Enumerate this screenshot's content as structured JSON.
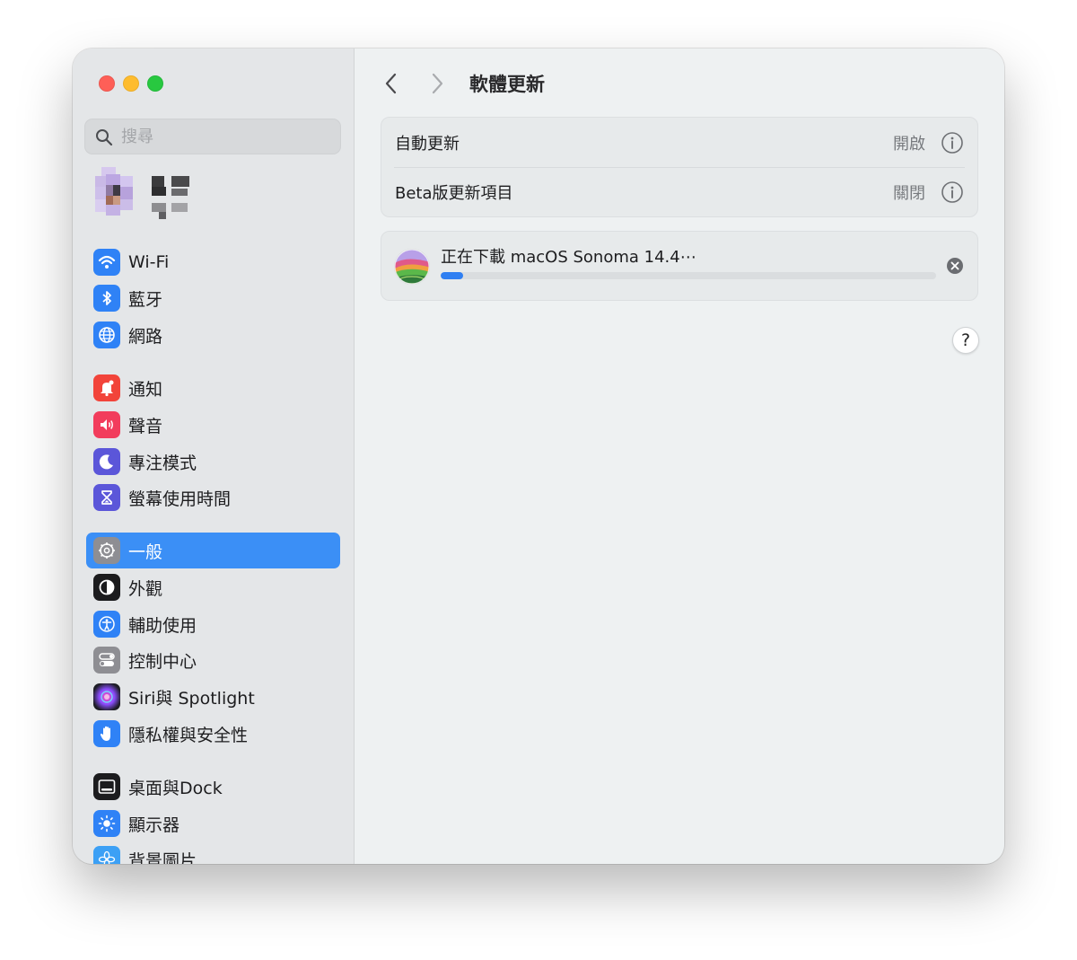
{
  "sidebar": {
    "search_placeholder": "搜尋",
    "items": [
      {
        "label": "Wi-Fi"
      },
      {
        "label": "藍牙"
      },
      {
        "label": "網路"
      },
      {
        "label": "通知"
      },
      {
        "label": "聲音"
      },
      {
        "label": "專注模式"
      },
      {
        "label": "螢幕使用時間"
      },
      {
        "label": "一般"
      },
      {
        "label": "外觀"
      },
      {
        "label": "輔助使用"
      },
      {
        "label": "控制中心"
      },
      {
        "label": "Siri與 Spotlight"
      },
      {
        "label": "隱私權與安全性"
      },
      {
        "label": "桌面與Dock"
      },
      {
        "label": "顯示器"
      },
      {
        "label": "背景圖片"
      }
    ],
    "selected": "一般"
  },
  "main": {
    "title": "軟體更新",
    "settings": [
      {
        "label": "自動更新",
        "value": "開啟"
      },
      {
        "label": "Beta版更新項目",
        "value": "關閉"
      }
    ],
    "download": {
      "title": "正在下載 macOS Sonoma 14.4⋯",
      "progress_percent": 4.5
    },
    "help_label": "?"
  },
  "colors": {
    "accent": "#3b8ff6",
    "progress": "#2f7ff2"
  }
}
